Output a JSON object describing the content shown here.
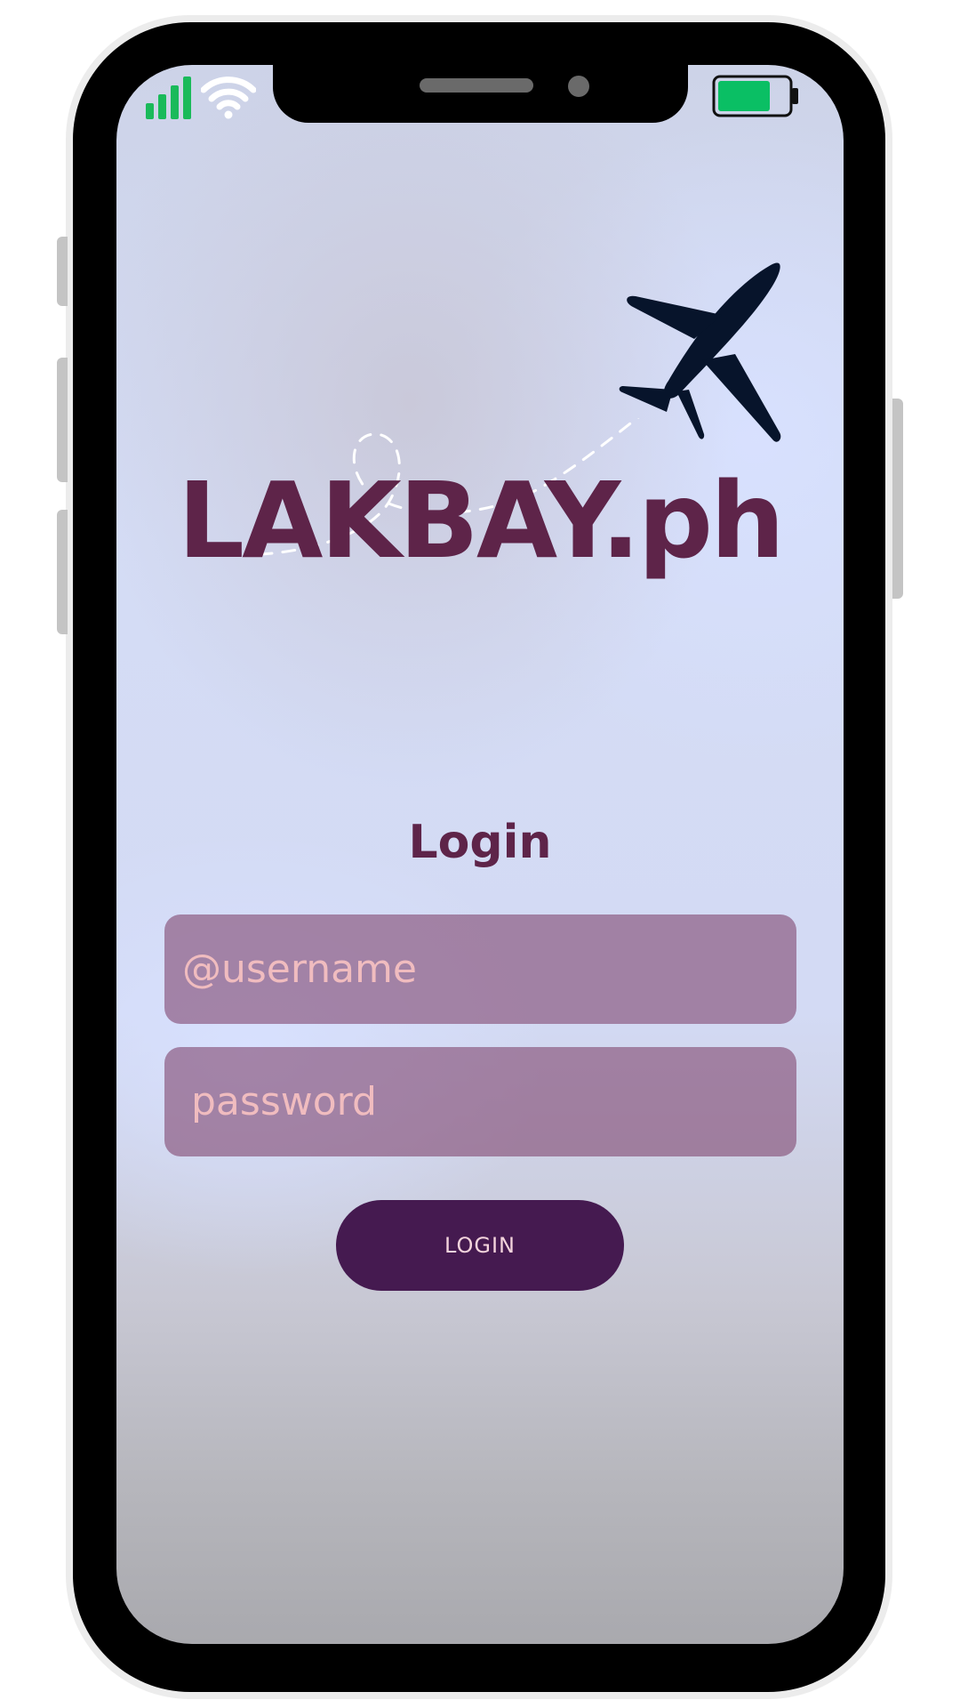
{
  "app": {
    "logo_text": "LAKBAY.ph"
  },
  "status_bar": {
    "signal_icon": "cellular-signal-icon",
    "wifi_icon": "wifi-icon",
    "battery_icon": "battery-icon",
    "battery_level": 0.75,
    "signal_color": "#1aba5a",
    "battery_color": "#0abf64"
  },
  "hero": {
    "plane_icon": "airplane-icon",
    "plane_color": "#07142b"
  },
  "login": {
    "title": "Login",
    "username_placeholder": "@username",
    "password_placeholder": "password",
    "button_label": "LOGIN"
  },
  "colors": {
    "brand": "#5e2449",
    "button": "#451a50",
    "field_text": "#f0bcbf"
  }
}
